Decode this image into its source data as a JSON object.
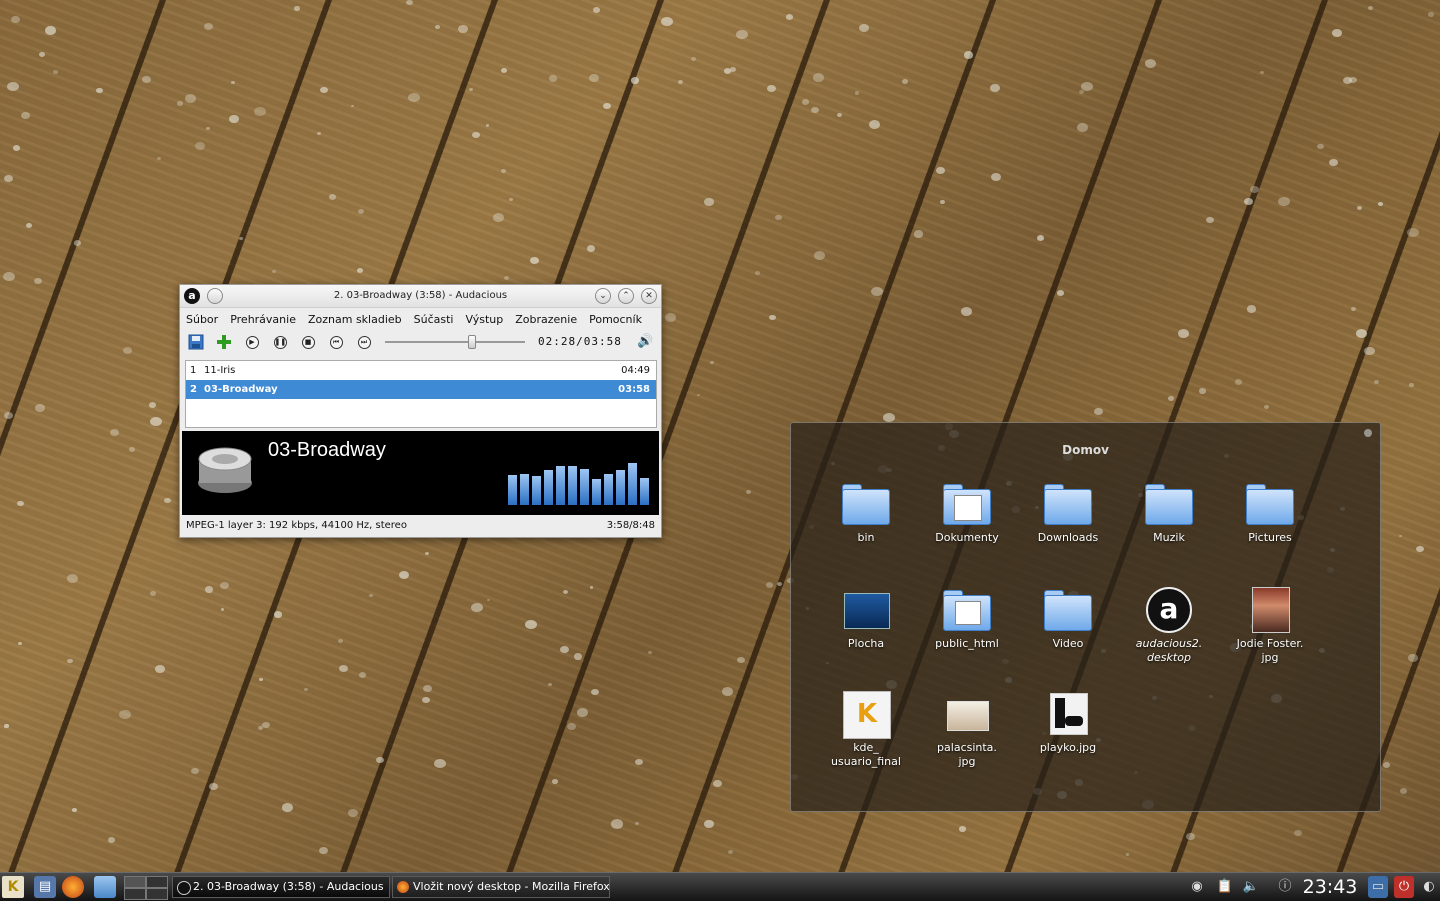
{
  "audacious": {
    "window_title": "2. 03-Broadway (3:58) - Audacious",
    "menu": [
      "Súbor",
      "Prehrávanie",
      "Zoznam skladieb",
      "Súčasti",
      "Výstup",
      "Zobrazenie",
      "Pomocník"
    ],
    "time_display": "02:28/03:58",
    "seek_position": 0.62,
    "playlist": [
      {
        "num": "1",
        "title": "11-Iris",
        "duration": "04:49"
      },
      {
        "num": "2",
        "title": "03-Broadway",
        "duration": "03:58"
      }
    ],
    "now_playing": "03-Broadway",
    "visualizer_levels": [
      0.68,
      0.7,
      0.66,
      0.8,
      0.88,
      0.88,
      0.82,
      0.6,
      0.7,
      0.8,
      0.95,
      0.62
    ],
    "status_left": "MPEG-1 layer 3: 192 kbps, 44100 Hz, stereo",
    "status_right": "3:58/8:48",
    "selection_color": "#3e8ad5"
  },
  "folderview": {
    "title": "Domov",
    "items": [
      {
        "label": "bin",
        "icon": "folder-icon"
      },
      {
        "label": "Dokumenty",
        "icon": "documents-folder-icon"
      },
      {
        "label": "Downloads",
        "icon": "folder-icon"
      },
      {
        "label": "Muzik",
        "icon": "folder-icon"
      },
      {
        "label": "Pictures",
        "icon": "folder-icon"
      },
      {
        "label": "Plocha",
        "icon": "desktop-folder-icon"
      },
      {
        "label": "public_html",
        "icon": "web-folder-icon"
      },
      {
        "label": "Video",
        "icon": "folder-icon"
      },
      {
        "label": "audacious2.\ndesktop",
        "icon": "audacious-launcher-icon"
      },
      {
        "label": "Jodie Foster.\njpg",
        "icon": "image-thumbnail-icon"
      },
      {
        "label": "kde_\nusuario_final",
        "icon": "kde-logo-icon"
      },
      {
        "label": "palacsinta.\njpg",
        "icon": "image-thumbnail-icon"
      },
      {
        "label": "playko.jpg",
        "icon": "image-thumbnail-icon"
      }
    ]
  },
  "taskbar": {
    "tasks": [
      {
        "label": "2. 03-Broadway (3:58) - Audacious",
        "icon": "audacious-icon"
      },
      {
        "label": "Vložit nový desktop - Mozilla Firefox",
        "icon": "firefox-icon"
      }
    ],
    "clock": "23:43"
  }
}
